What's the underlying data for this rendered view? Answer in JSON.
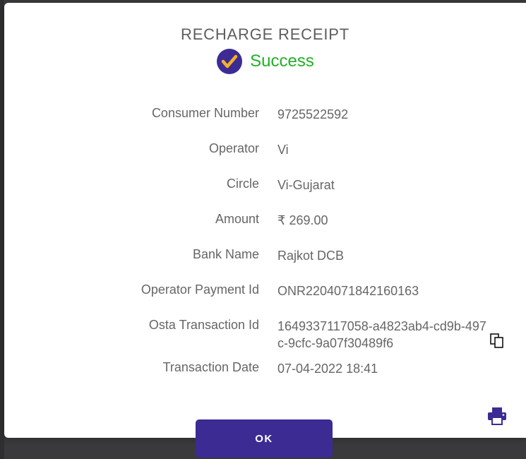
{
  "receipt": {
    "title": "RECHARGE RECEIPT",
    "status_text": "Success",
    "colors": {
      "accent": "#3d2b94",
      "success": "#21b027",
      "check": "#f2b12b"
    },
    "icons": {
      "status": "check-circle-icon",
      "copy": "copy-icon",
      "print": "printer-icon"
    },
    "fields": [
      {
        "label": "Consumer Number",
        "value": "9725522592"
      },
      {
        "label": "Operator",
        "value": "Vi"
      },
      {
        "label": "Circle",
        "value": "Vi-Gujarat"
      },
      {
        "label": "Amount",
        "value": "₹ 269.00"
      },
      {
        "label": "Bank Name",
        "value": "Rajkot DCB"
      },
      {
        "label": "Operator Payment Id",
        "value": "ONR2204071842160163"
      },
      {
        "label": "Osta Transaction Id",
        "value": "1649337117058-a4823ab4-cd9b-497c-9cfc-9a07f30489f6"
      },
      {
        "label": "Transaction Date",
        "value": "07-04-2022 18:41"
      }
    ],
    "ok_label": "OK"
  }
}
